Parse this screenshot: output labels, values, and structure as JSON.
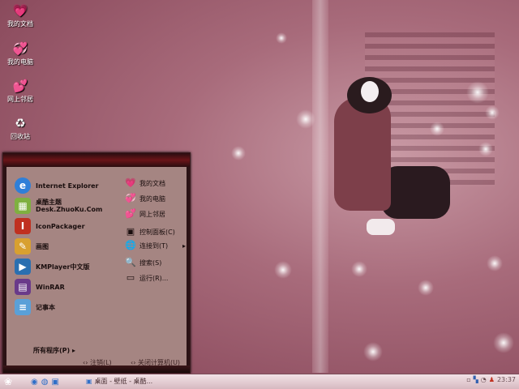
{
  "desktop_icons": [
    {
      "label": "我的文档",
      "icon": "heart-doc-icon"
    },
    {
      "label": "我的电脑",
      "icon": "heart-computer-icon"
    },
    {
      "label": "网上邻居",
      "icon": "heart-network-icon"
    },
    {
      "label": "回收站",
      "icon": "recycle-bin-icon"
    }
  ],
  "start_menu": {
    "programs": [
      {
        "label": "Internet Explorer",
        "icon": "ie-icon",
        "color": "#2f7fd8"
      },
      {
        "label": "桌酷主题",
        "sub": "Desk.ZhuoKu.Com",
        "icon": "zhuoku-icon",
        "color": "#7fb040"
      },
      {
        "label": "IconPackager",
        "icon": "iconpackager-icon",
        "color": "#c03020"
      },
      {
        "label": "画图",
        "icon": "paint-icon",
        "color": "#d8a030"
      },
      {
        "label": "KMPlayer中文版",
        "icon": "kmplayer-icon",
        "color": "#2a6fb0"
      },
      {
        "label": "WinRAR",
        "icon": "winrar-icon",
        "color": "#6a3a8a"
      },
      {
        "label": "记事本",
        "icon": "notepad-icon",
        "color": "#5aa0d8"
      }
    ],
    "places": [
      {
        "label": "我的文档",
        "icon": "heart-doc-icon"
      },
      {
        "label": "我的电脑",
        "icon": "heart-computer-icon"
      },
      {
        "label": "网上邻居",
        "icon": "heart-network-icon"
      },
      {
        "label": "控制面板(C)",
        "icon": "control-panel-icon"
      },
      {
        "label": "连接到(T)",
        "icon": "globe-icon",
        "arrow": "▸"
      },
      {
        "label": "搜索(S)",
        "icon": "search-icon"
      },
      {
        "label": "运行(R)...",
        "icon": "run-icon"
      }
    ],
    "all_programs": "所有程序(P)",
    "all_arrow": "▸",
    "logoff": "注销(L)",
    "shutdown": "关闭计算机(U)"
  },
  "taskbar": {
    "window_label": "桌面 - 壁纸 - 桌酷...",
    "clock": "23:37"
  }
}
